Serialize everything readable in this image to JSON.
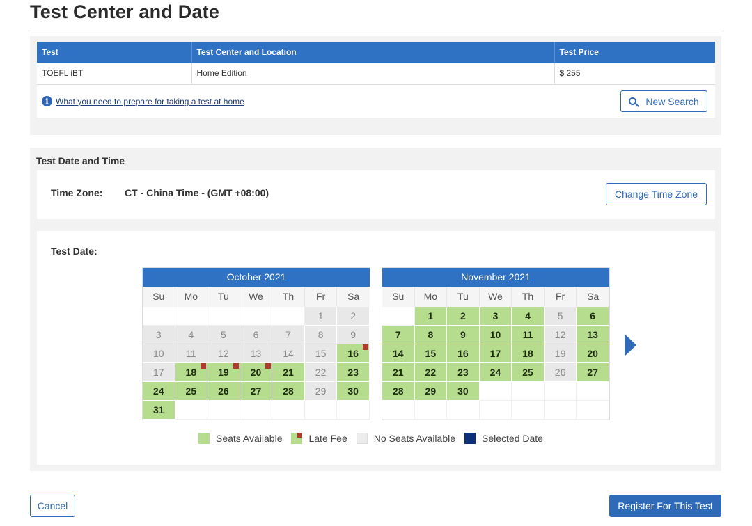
{
  "page": {
    "title": "Test Center and Date"
  },
  "summary": {
    "headers": [
      "Test",
      "Test Center and Location",
      "Test Price"
    ],
    "row": [
      "TOEFL iBT",
      "Home Edition",
      "$ 255"
    ],
    "info_link": "What you need to prepare for taking a test at home",
    "new_search_label": "New Search"
  },
  "date_section": {
    "title": "Test Date and Time",
    "time_zone_label": "Time Zone:",
    "time_zone_value": "CT - China Time - (GMT +08:00)",
    "change_tz_label": "Change Time Zone",
    "test_date_label": "Test Date:"
  },
  "calendars": [
    {
      "id": "oct",
      "title": "October 2021",
      "days_of_week": [
        "Su",
        "Mo",
        "Tu",
        "We",
        "Th",
        "Fr",
        "Sa"
      ],
      "weeks": [
        [
          [
            "",
            ""
          ],
          [
            "",
            ""
          ],
          [
            "",
            ""
          ],
          [
            "",
            ""
          ],
          [
            "",
            ""
          ],
          [
            "1",
            "n"
          ],
          [
            "2",
            "n"
          ]
        ],
        [
          [
            "3",
            "n"
          ],
          [
            "4",
            "n"
          ],
          [
            "5",
            "n"
          ],
          [
            "6",
            "n"
          ],
          [
            "7",
            "n"
          ],
          [
            "8",
            "n"
          ],
          [
            "9",
            "n"
          ]
        ],
        [
          [
            "10",
            "n"
          ],
          [
            "11",
            "n"
          ],
          [
            "12",
            "n"
          ],
          [
            "13",
            "n"
          ],
          [
            "14",
            "n"
          ],
          [
            "15",
            "n"
          ],
          [
            "16",
            "l"
          ]
        ],
        [
          [
            "17",
            "n"
          ],
          [
            "18",
            "l"
          ],
          [
            "19",
            "l"
          ],
          [
            "20",
            "l"
          ],
          [
            "21",
            "a"
          ],
          [
            "22",
            "n"
          ],
          [
            "23",
            "a"
          ]
        ],
        [
          [
            "24",
            "a"
          ],
          [
            "25",
            "a"
          ],
          [
            "26",
            "a"
          ],
          [
            "27",
            "a"
          ],
          [
            "28",
            "a"
          ],
          [
            "29",
            "n"
          ],
          [
            "30",
            "a"
          ]
        ],
        [
          [
            "31",
            "a"
          ],
          [
            "",
            ""
          ],
          [
            "",
            ""
          ],
          [
            "",
            ""
          ],
          [
            "",
            ""
          ],
          [
            "",
            ""
          ],
          [
            "",
            ""
          ]
        ]
      ]
    },
    {
      "id": "nov",
      "title": "November 2021",
      "days_of_week": [
        "Su",
        "Mo",
        "Tu",
        "We",
        "Th",
        "Fr",
        "Sa"
      ],
      "weeks": [
        [
          [
            "",
            ""
          ],
          [
            "1",
            "a"
          ],
          [
            "2",
            "a"
          ],
          [
            "3",
            "a"
          ],
          [
            "4",
            "a"
          ],
          [
            "5",
            "n"
          ],
          [
            "6",
            "a"
          ]
        ],
        [
          [
            "7",
            "a"
          ],
          [
            "8",
            "a"
          ],
          [
            "9",
            "a"
          ],
          [
            "10",
            "a"
          ],
          [
            "11",
            "a"
          ],
          [
            "12",
            "n"
          ],
          [
            "13",
            "a"
          ]
        ],
        [
          [
            "14",
            "a"
          ],
          [
            "15",
            "a"
          ],
          [
            "16",
            "a"
          ],
          [
            "17",
            "a"
          ],
          [
            "18",
            "a"
          ],
          [
            "19",
            "n"
          ],
          [
            "20",
            "a"
          ]
        ],
        [
          [
            "21",
            "a"
          ],
          [
            "22",
            "a"
          ],
          [
            "23",
            "a"
          ],
          [
            "24",
            "a"
          ],
          [
            "25",
            "a"
          ],
          [
            "26",
            "n"
          ],
          [
            "27",
            "a"
          ]
        ],
        [
          [
            "28",
            "a"
          ],
          [
            "29",
            "a"
          ],
          [
            "30",
            "a"
          ],
          [
            "",
            ""
          ],
          [
            "",
            ""
          ],
          [
            "",
            ""
          ],
          [
            "",
            ""
          ]
        ],
        [
          [
            "",
            ""
          ],
          [
            "",
            ""
          ],
          [
            "",
            ""
          ],
          [
            "",
            ""
          ],
          [
            "",
            ""
          ],
          [
            "",
            ""
          ],
          [
            "",
            ""
          ]
        ]
      ]
    }
  ],
  "legend": {
    "seats_available": "Seats Available",
    "late_fee": "Late Fee",
    "no_seats": "No Seats Available",
    "selected": "Selected Date"
  },
  "colors": {
    "primary": "#2f6ab8",
    "header_blue": "#2f72c4",
    "available": "#b6dc8e",
    "late_fee_marker": "#b03a2e",
    "no_seats": "#e8e8e8",
    "selected": "#0e2f7a"
  },
  "footer": {
    "cancel_label": "Cancel",
    "register_label": "Register For This Test"
  }
}
